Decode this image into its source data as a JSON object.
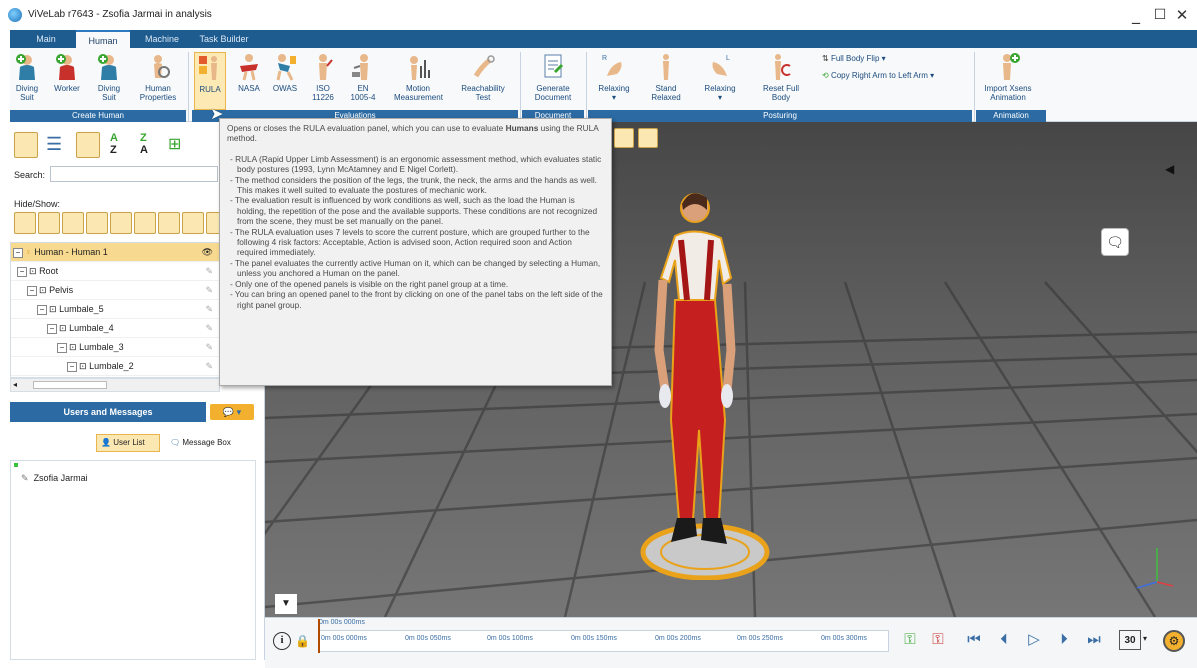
{
  "window": {
    "title": "ViVeLab r7643 - Zsofia Jarmai in analysis"
  },
  "tabs": [
    {
      "label": "Main",
      "active": false
    },
    {
      "label": "Human",
      "active": true
    },
    {
      "label": "Machine",
      "active": false
    },
    {
      "label": "Task Builder",
      "active": false
    }
  ],
  "ribbon": {
    "create_human": {
      "group_label": "Create Human",
      "buttons": [
        {
          "label1": "Diving",
          "label2": "Suit",
          "dropdown": true
        },
        {
          "label1": "Worker",
          "label2": "",
          "dropdown": true
        },
        {
          "label1": "Diving",
          "label2": "Suit",
          "dropdown": true
        },
        {
          "label1": "Human",
          "label2": "Properties",
          "dropdown": false
        }
      ]
    },
    "evaluations": {
      "group_label": "Evaluations",
      "buttons": [
        {
          "label1": "RULA",
          "label2": ""
        },
        {
          "label1": "NASA",
          "label2": ""
        },
        {
          "label1": "OWAS",
          "label2": ""
        },
        {
          "label1": "ISO",
          "label2": "11226"
        },
        {
          "label1": "EN",
          "label2": "1005-4"
        },
        {
          "label1": "Motion",
          "label2": "Measurement"
        },
        {
          "label1": "Reachability",
          "label2": "Test"
        }
      ]
    },
    "document": {
      "group_label": "Document",
      "buttons": [
        {
          "label1": "Generate",
          "label2": "Document"
        }
      ]
    },
    "posturing": {
      "group_label": "Posturing",
      "buttons": [
        {
          "label1": "Relaxing",
          "label2": "",
          "badge": "R"
        },
        {
          "label1": "Stand",
          "label2": "Relaxed"
        },
        {
          "label1": "Relaxing",
          "label2": "",
          "badge": "L"
        },
        {
          "label1": "Reset Full",
          "label2": "Body"
        }
      ],
      "small_buttons": [
        "Full Body Flip",
        "Copy Right Arm to Left Arm"
      ]
    },
    "animation": {
      "group_label": "Animation",
      "buttons": [
        {
          "label1": "Import Xsens",
          "label2": "Animation"
        }
      ]
    }
  },
  "left_panel": {
    "search_label": "Search:",
    "search_value": "",
    "hide_show_label": "Hide/Show:",
    "tree": [
      {
        "label": "Human - Human 1",
        "level": 0
      },
      {
        "label": "Root",
        "level": 1
      },
      {
        "label": "Pelvis",
        "level": 2
      },
      {
        "label": "Lumbale_5",
        "level": 3
      },
      {
        "label": "Lumbale_4",
        "level": 4
      },
      {
        "label": "Lumbale_3",
        "level": 5
      },
      {
        "label": "Lumbale_2",
        "level": 6
      }
    ],
    "users_header": "Users and Messages",
    "user_list_label": "User List",
    "message_box_label": "Message Box",
    "users": [
      "Zsofia Jarmai"
    ]
  },
  "tooltip": {
    "intro_1": "Opens or closes the RULA evaluation panel, which you can use to evaluate ",
    "intro_bold": "Humans",
    "intro_2": " using the RULA method.",
    "items": [
      "RULA (Rapid Upper Limb Assessment) is an ergonomic assessment method, which evaluates static body postures (1993, Lynn McAtamney and E Nigel Corlett).",
      "The method considers the position of the legs, the trunk, the neck, the arms and the hands as well. This makes it well suited to evaluate the postures of mechanic work.",
      "The evaluation result is influenced by work conditions as well, such as the load the Human is holding, the repetition of the pose and the available supports. These conditions are not recognized from the scene, they must be set manually on the panel.",
      "The RULA evaluation uses 7 levels to score the current posture, which are grouped further to the following 4 risk factors: Acceptable, Action is advised soon, Action required soon and Action required immediately.",
      "The panel evaluates the currently active Human on it, which can be changed by selecting a Human, unless you anchored a Human on the panel.",
      "Only one of the opened panels is visible on the right panel group at a time.",
      "You can bring an opened panel to the front by clicking on one of the panel tabs on the left side of the right panel group."
    ]
  },
  "timeline": {
    "current": "0m 00s 000ms",
    "ticks": [
      "0m 00s 000ms",
      "0m 00s 050ms",
      "0m 00s 100ms",
      "0m 00s 150ms",
      "0m 00s 200ms",
      "0m 00s 250ms",
      "0m 00s 300ms"
    ],
    "fps": "30"
  }
}
